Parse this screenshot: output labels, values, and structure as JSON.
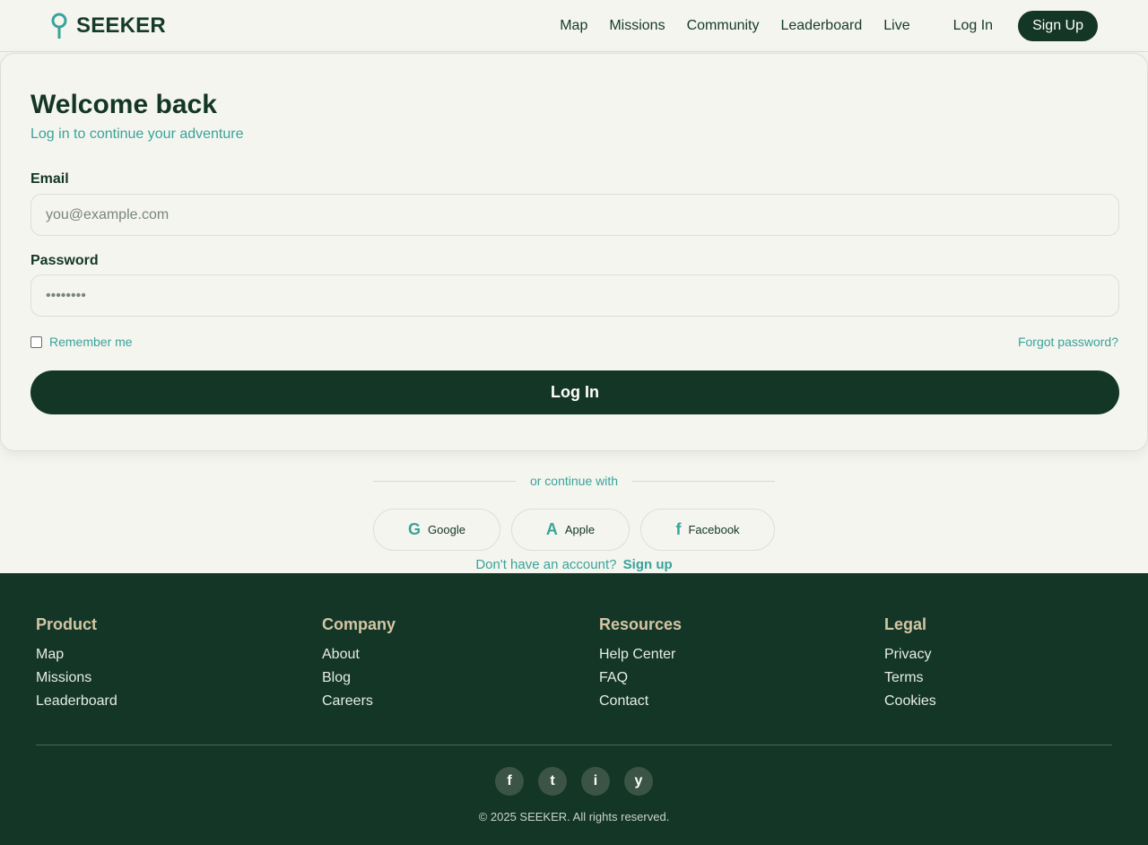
{
  "brand": {
    "name": "SEEKER",
    "icon": "location-pin-icon",
    "accent": "#3aa39a"
  },
  "nav": {
    "links": [
      "Map",
      "Missions",
      "Community",
      "Leaderboard",
      "Live"
    ],
    "login_label": "Log In",
    "signup_label": "Sign Up"
  },
  "login": {
    "title": "Welcome back",
    "subtitle": "Log in to continue your adventure",
    "email_label": "Email",
    "email_placeholder": "you@example.com",
    "password_label": "Password",
    "password_placeholder": "••••••••",
    "remember_label": "Remember me",
    "forgot_label": "Forgot password?",
    "submit_label": "Log In"
  },
  "social": {
    "divider_text": "or continue with",
    "providers": [
      {
        "glyph": "G",
        "label": "Google",
        "icon": "google-icon"
      },
      {
        "glyph": "A",
        "label": "Apple",
        "icon": "apple-icon"
      },
      {
        "glyph": "f",
        "label": "Facebook",
        "icon": "facebook-icon"
      }
    ],
    "prompt_text": "Don't have an account?",
    "prompt_link": "Sign up"
  },
  "footer": {
    "columns": [
      {
        "heading": "Product",
        "links": [
          "Map",
          "Missions",
          "Leaderboard"
        ]
      },
      {
        "heading": "Company",
        "links": [
          "About",
          "Blog",
          "Careers"
        ]
      },
      {
        "heading": "Resources",
        "links": [
          "Help Center",
          "FAQ",
          "Contact"
        ]
      },
      {
        "heading": "Legal",
        "links": [
          "Privacy",
          "Terms",
          "Cookies"
        ]
      }
    ],
    "social_icons": [
      {
        "glyph": "f",
        "icon": "facebook-icon"
      },
      {
        "glyph": "t",
        "icon": "twitter-icon"
      },
      {
        "glyph": "i",
        "icon": "instagram-icon"
      },
      {
        "glyph": "y",
        "icon": "youtube-icon"
      }
    ],
    "copyright": "© 2025 SEEKER. All rights reserved."
  },
  "colors": {
    "primary": "#143626",
    "background": "#f4f5ef",
    "accent": "#3aa39a",
    "footer_heading": "#d4c6a4"
  }
}
